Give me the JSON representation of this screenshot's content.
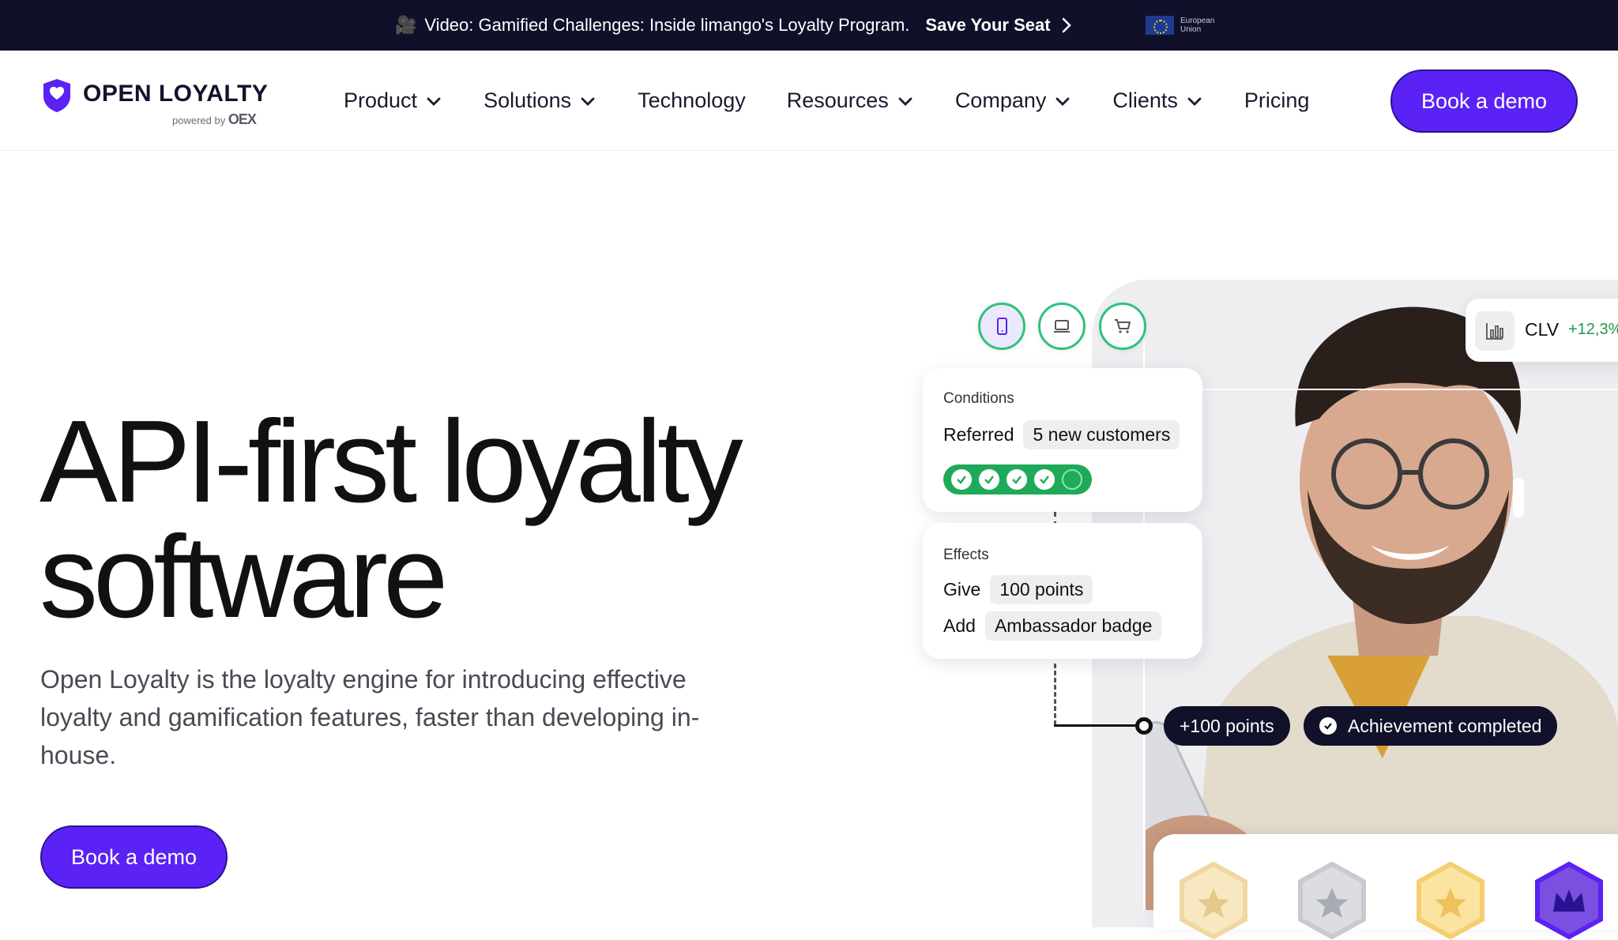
{
  "announcement": {
    "icon": "video-camera-icon",
    "text": "Video: Gamified Challenges: Inside limango's Loyalty Program.",
    "cta": "Save Your Seat",
    "eu_label_line1": "European",
    "eu_label_line2": "Union"
  },
  "brand": {
    "name": "OPEN LOYALTY",
    "powered_by": "powered by",
    "partner": "OEX",
    "accent": "#5a22f5"
  },
  "nav": {
    "items": [
      {
        "label": "Product",
        "dropdown": true
      },
      {
        "label": "Solutions",
        "dropdown": true
      },
      {
        "label": "Technology",
        "dropdown": false
      },
      {
        "label": "Resources",
        "dropdown": true
      },
      {
        "label": "Company",
        "dropdown": true
      },
      {
        "label": "Clients",
        "dropdown": true
      },
      {
        "label": "Pricing",
        "dropdown": false
      }
    ],
    "cta": "Book a demo"
  },
  "hero": {
    "title_line1": "API-first loyalty",
    "title_line2": "software",
    "subtitle": "Open Loyalty is the loyalty engine for introducing effective loyalty and gamification features, faster than developing in-house.",
    "cta": "Book a demo"
  },
  "illustration": {
    "channels": [
      "mobile-icon",
      "laptop-icon",
      "cart-icon"
    ],
    "conditions_card": {
      "label": "Conditions",
      "row_label": "Referred",
      "row_value": "5 new customers",
      "progress_done": 4,
      "progress_total": 5
    },
    "effects_card": {
      "label": "Effects",
      "row1_label": "Give",
      "row1_value": "100 points",
      "row2_label": "Add",
      "row2_value": "Ambassador badge"
    },
    "points_chip": "+100 points",
    "achievement_chip": "Achievement completed",
    "clv": {
      "label": "CLV",
      "value": "+12,3%"
    }
  }
}
